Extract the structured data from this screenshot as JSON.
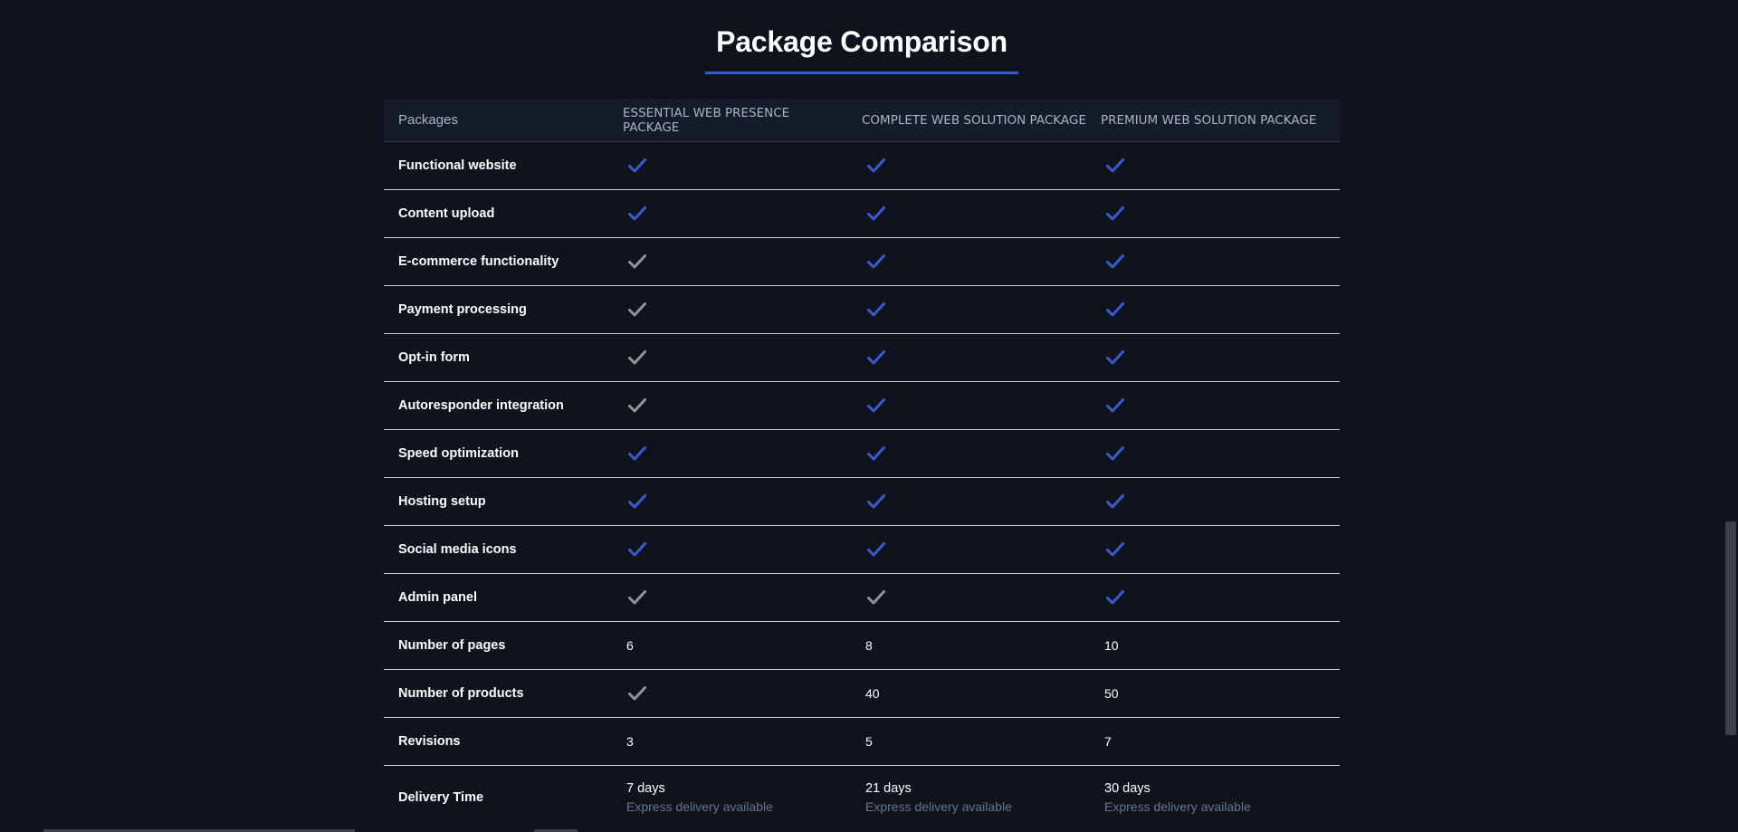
{
  "title": "Package Comparison",
  "colors": {
    "background": "#0e131d",
    "accent": "#3a5bd0",
    "check_included": "#3a5bd0",
    "check_not_highlighted": "#8d95a3"
  },
  "table": {
    "headers": [
      "Packages",
      "ESSENTIAL WEB PRESENCE PACKAGE",
      "COMPLETE WEB SOLUTION PACKAGE",
      "PREMIUM WEB SOLUTION PACKAGE"
    ],
    "rows": [
      {
        "feature": "Functional website",
        "cells": [
          {
            "type": "check",
            "color": "blue"
          },
          {
            "type": "check",
            "color": "blue"
          },
          {
            "type": "check",
            "color": "blue"
          }
        ]
      },
      {
        "feature": "Content upload",
        "cells": [
          {
            "type": "check",
            "color": "blue"
          },
          {
            "type": "check",
            "color": "blue"
          },
          {
            "type": "check",
            "color": "blue"
          }
        ]
      },
      {
        "feature": "E-commerce functionality",
        "cells": [
          {
            "type": "check",
            "color": "gray"
          },
          {
            "type": "check",
            "color": "blue"
          },
          {
            "type": "check",
            "color": "blue"
          }
        ]
      },
      {
        "feature": "Payment processing",
        "cells": [
          {
            "type": "check",
            "color": "gray"
          },
          {
            "type": "check",
            "color": "blue"
          },
          {
            "type": "check",
            "color": "blue"
          }
        ]
      },
      {
        "feature": "Opt-in form",
        "cells": [
          {
            "type": "check",
            "color": "gray"
          },
          {
            "type": "check",
            "color": "blue"
          },
          {
            "type": "check",
            "color": "blue"
          }
        ]
      },
      {
        "feature": "Autoresponder integration",
        "cells": [
          {
            "type": "check",
            "color": "gray"
          },
          {
            "type": "check",
            "color": "blue"
          },
          {
            "type": "check",
            "color": "blue"
          }
        ]
      },
      {
        "feature": "Speed optimization",
        "cells": [
          {
            "type": "check",
            "color": "blue"
          },
          {
            "type": "check",
            "color": "blue"
          },
          {
            "type": "check",
            "color": "blue"
          }
        ]
      },
      {
        "feature": "Hosting setup",
        "cells": [
          {
            "type": "check",
            "color": "blue"
          },
          {
            "type": "check",
            "color": "blue"
          },
          {
            "type": "check",
            "color": "blue"
          }
        ]
      },
      {
        "feature": "Social media icons",
        "cells": [
          {
            "type": "check",
            "color": "blue"
          },
          {
            "type": "check",
            "color": "blue"
          },
          {
            "type": "check",
            "color": "blue"
          }
        ]
      },
      {
        "feature": "Admin panel",
        "cells": [
          {
            "type": "check",
            "color": "gray"
          },
          {
            "type": "check",
            "color": "gray"
          },
          {
            "type": "check",
            "color": "blue"
          }
        ]
      },
      {
        "feature": "Number of pages",
        "cells": [
          {
            "type": "text",
            "value": "6"
          },
          {
            "type": "text",
            "value": "8"
          },
          {
            "type": "text",
            "value": "10"
          }
        ]
      },
      {
        "feature": "Number of products",
        "cells": [
          {
            "type": "check",
            "color": "gray"
          },
          {
            "type": "text",
            "value": "40"
          },
          {
            "type": "text",
            "value": "50"
          }
        ]
      },
      {
        "feature": "Revisions",
        "cells": [
          {
            "type": "text",
            "value": "3"
          },
          {
            "type": "text",
            "value": "5"
          },
          {
            "type": "text",
            "value": "7"
          }
        ]
      }
    ],
    "delivery": {
      "feature": "Delivery Time",
      "cells": [
        {
          "days": "7 days",
          "note": "Express delivery available"
        },
        {
          "days": "21 days",
          "note": "Express delivery available"
        },
        {
          "days": "30 days",
          "note": "Express delivery available"
        }
      ]
    }
  }
}
